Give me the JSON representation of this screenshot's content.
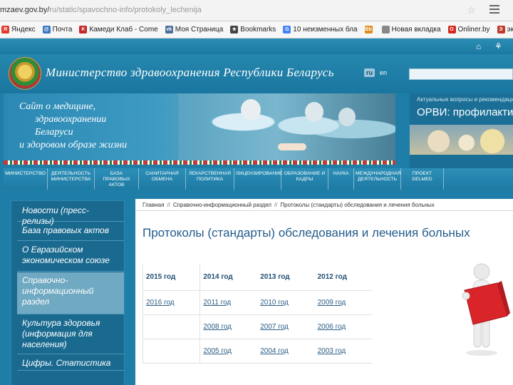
{
  "browser": {
    "url_prefix": "mzaev.gov.by/",
    "url_path": "ru/static/spavochno-info/protokoly_lechenija",
    "bookmarks": [
      {
        "label": "Яндекс",
        "icon": "yandex-icon",
        "color": "#e03c2b",
        "glyph": "Я"
      },
      {
        "label": "Почта",
        "icon": "mail-icon",
        "color": "#3b78c2",
        "glyph": "@"
      },
      {
        "label": "Камеди Клаб - Comе",
        "icon": "comedy-club-icon",
        "color": "#c3272b",
        "glyph": "K"
      },
      {
        "label": "Моя Страница",
        "icon": "vk-icon",
        "color": "#4b6f9a",
        "glyph": "vk"
      },
      {
        "label": "Bookmarks",
        "icon": "star-icon",
        "color": "#444444",
        "glyph": "★"
      },
      {
        "label": "10 неизменных бла",
        "icon": "g-icon",
        "color": "#4285f4",
        "glyph": "G"
      },
      {
        "label": "",
        "icon": "blogger-icon",
        "color": "#e08a1e",
        "glyph": "Bb"
      },
      {
        "label": "Новая вкладка",
        "icon": "page-icon",
        "color": "#888888",
        "glyph": ""
      },
      {
        "label": "Onliner.by",
        "icon": "onliner-icon",
        "color": "#d42a1e",
        "glyph": "O"
      },
      {
        "label": "экономич",
        "icon": "economy-icon",
        "color": "#c0392b",
        "glyph": "Э"
      }
    ]
  },
  "header": {
    "title": "Министерство здравоохранения Республики Беларусь",
    "lang_active": "ru",
    "lang_other": "en"
  },
  "banner": {
    "slogan": [
      "Сайт о медицине,",
      "здравоохранении",
      "Беларуси",
      "и здоровом образе жизни"
    ]
  },
  "promo": {
    "label": "Актуальные вопросы и рекомендации",
    "title": "ОРВИ: профилактика"
  },
  "nav": [
    "Министерство",
    "Деятельность министерства",
    "База правовых актов",
    "Санитарная обмена",
    "Лекарственная политика",
    "Лицензирование",
    "Образование и кадры",
    "Наука",
    "Международная деятельность",
    "Проект DELMED"
  ],
  "sidebar": [
    "Новости (пресс-релизы)",
    "База правовых актов",
    "О Евразийском экономическом союзе",
    "Справочно-информационный раздел",
    "Культура здоровья (информация для населения)",
    "Цифры. Статистика"
  ],
  "breadcrumb": [
    "Главная",
    "Справочно-информационный раздел",
    "Протоколы (стандарты) обследования и лечения больных"
  ],
  "page_title": "Протоколы (стандарты) обследования и лечения больных",
  "years": [
    [
      "2015 год",
      "2014 год",
      "2013 год",
      "2012 год"
    ],
    [
      "2016 год",
      "2011 год",
      "2010 год",
      "2009 год"
    ],
    [
      "",
      "2008 год",
      "2007 год",
      "2006 год"
    ],
    [
      "",
      "2005 год",
      "2004 год",
      "2003 год"
    ]
  ]
}
